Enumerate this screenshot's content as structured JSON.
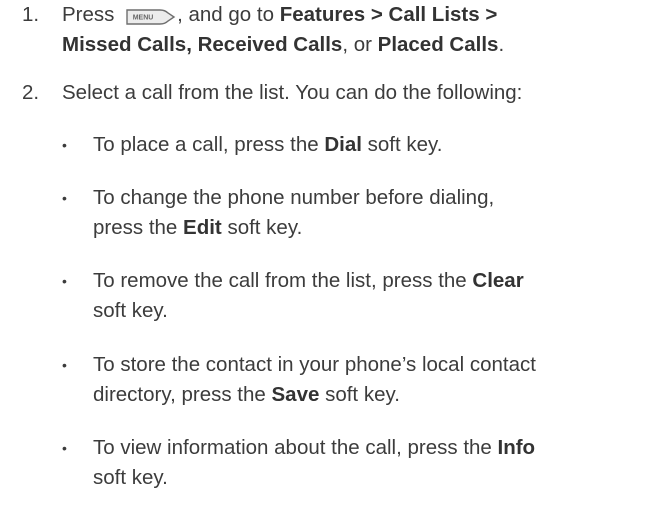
{
  "steps": [
    {
      "number": "1.",
      "line1_parts": [
        "Press ",
        ", and go to ",
        "Features > Call Lists >"
      ],
      "line2_parts": [
        "Missed Calls, Received Calls",
        ", or ",
        "Placed Calls",
        "."
      ],
      "menu_key_label": "MENU",
      "menu_key_icon": "menu-key-icon"
    },
    {
      "number": "2.",
      "text": "Select a call from the list. You can do the following:"
    }
  ],
  "bullets": [
    {
      "before": "To place a call, press the ",
      "key": "Dial",
      "after": " soft key."
    },
    {
      "before": "To change the phone number before dialing,",
      "line2_before": "press the ",
      "key": "Edit",
      "after": " soft key."
    },
    {
      "before": "To remove the call from the list, press the ",
      "key": "Clear",
      "line2_after": "soft key."
    },
    {
      "before": "To store the contact in your phone’s local contact",
      "line2_before": "directory, press the ",
      "key": "Save",
      "after": " soft key."
    },
    {
      "before": "To view information about the call, press the ",
      "key": "Info",
      "line2_after": "soft key."
    }
  ]
}
